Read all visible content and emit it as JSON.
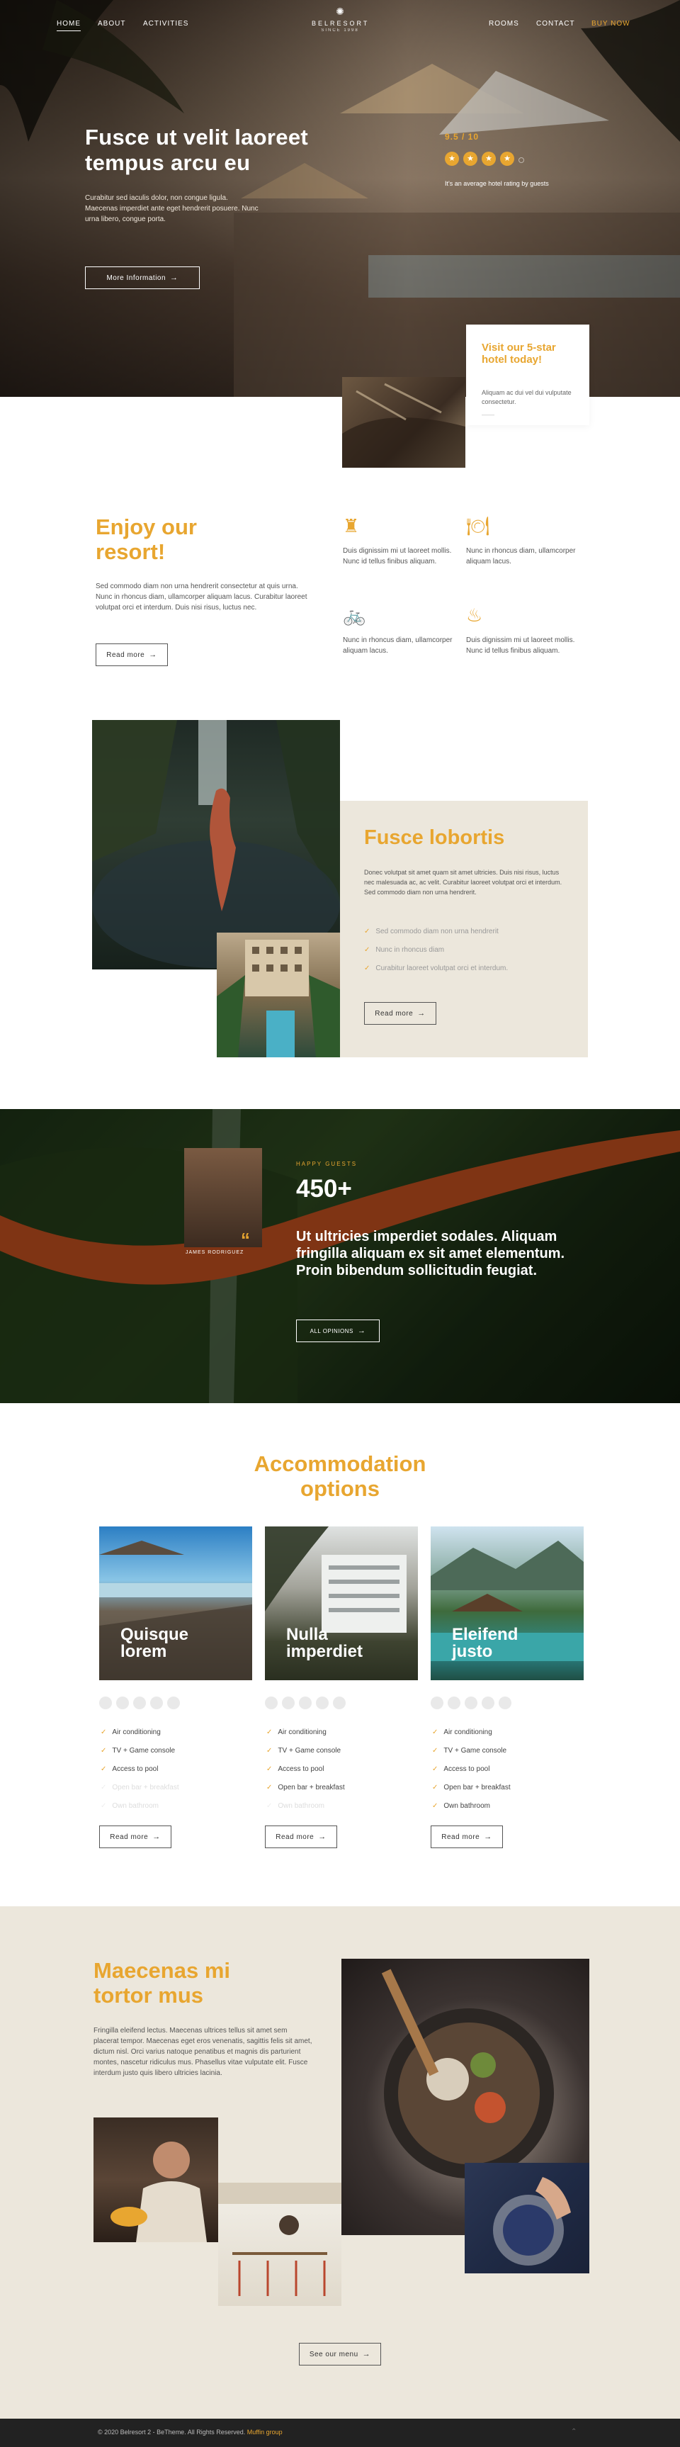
{
  "nav": {
    "left": [
      "HOME",
      "ABOUT",
      "ACTIVITIES"
    ],
    "logo_name": "BELRESORT",
    "logo_tag": "SINCE 1998",
    "right": [
      "ROOMS",
      "CONTACT",
      "BUY NOW"
    ]
  },
  "hero": {
    "title_line1": "Fusce ut velit laoreet",
    "title_line2": "tempus arcu eu",
    "text": "Curabitur sed iaculis dolor, non congue ligula. Maecenas imperdiet ante eget hendrerit posuere. Nunc urna libero, congue porta.",
    "button": "More Information",
    "rating": "9.5 / 10",
    "rating_stars": 4,
    "rating_caption": "It's an average hotel rating by guests",
    "promo_title": "Visit our 5-star hotel today!",
    "promo_text": "Aliquam ac dui vel dui vulputate consectetur.",
    "promo_dash": "——"
  },
  "enjoy": {
    "title_line1": "Enjoy our",
    "title_line2": "resort!",
    "text": "Sed commodo diam non urna hendrerit consectetur at quis urna. Nunc in rhoncus diam, ullamcorper aliquam lacus. Curabitur laoreet volutpat orci et interdum. Duis nisi risus, luctus nec.",
    "button": "Read more",
    "features": [
      {
        "icon": "castle-icon",
        "glyph": "♜",
        "text": "Duis dignissim mi ut laoreet mollis. Nunc id tellus finibus aliquam."
      },
      {
        "icon": "meal-icon",
        "glyph": "🍽",
        "text": "Nunc in rhoncus diam, ullamcorper aliquam lacus."
      },
      {
        "icon": "bicycle-icon",
        "glyph": "🚲",
        "text": "Nunc in rhoncus diam, ullamcorper aliquam lacus."
      },
      {
        "icon": "pool-icon",
        "glyph": "♨",
        "text": "Duis dignissim mi ut laoreet mollis. Nunc id tellus finibus aliquam."
      }
    ]
  },
  "fusce": {
    "title": "Fusce lobortis",
    "text": "Donec volutpat sit amet quam sit amet ultricies. Duis nisi risus, luctus nec malesuada ac, ac velit. Curabitur laoreet volutpat orci et interdum. Sed commodo diam non urna hendrerit.",
    "items": [
      "Sed commodo diam non urna hendrerit",
      "Nunc in rhoncus diam",
      "Curabitur laoreet volutpat orci et interdum."
    ],
    "button": "Read more"
  },
  "testimonial": {
    "label": "HAPPY GUESTS",
    "count": "450+",
    "quote": "Ut ultricies imperdiet sodales. Aliquam fringilla aliquam ex sit amet elementum. Proin bibendum sollicitudin feugiat.",
    "author": "JAMES RODRIGUEZ",
    "button": "ALL OPINIONS"
  },
  "accommodation": {
    "title_line1": "Accommodation",
    "title_line2": "options",
    "cards": [
      {
        "title1": "Quisque",
        "title2": "lorem",
        "features": [
          "Air conditioning",
          "TV + Game console",
          "Access to pool",
          "Open bar + breakfast",
          "Own bathroom"
        ],
        "faded_from": 3,
        "button": "Read more"
      },
      {
        "title1": "Nulla",
        "title2": "imperdiet",
        "features": [
          "Air conditioning",
          "TV + Game console",
          "Access to pool",
          "Open bar + breakfast",
          "Own bathroom"
        ],
        "faded_from": 4,
        "button": "Read more"
      },
      {
        "title1": "Eleifend",
        "title2": "justo",
        "features": [
          "Air conditioning",
          "TV + Game console",
          "Access to pool",
          "Open bar + breakfast",
          "Own bathroom"
        ],
        "faded_from": 5,
        "button": "Read more"
      }
    ]
  },
  "maecenas": {
    "title_line1": "Maecenas mi",
    "title_line2": "tortor mus",
    "text": "Fringilla eleifend lectus. Maecenas ultrices tellus sit amet sem placerat tempor. Maecenas eget eros venenatis, sagittis felis sit amet, dictum nisl. Orci varius natoque penatibus et magnis dis parturient montes, nascetur ridiculus mus. Phasellus vitae vulputate elit. Fusce interdum justo quis libero ultricies lacinia.",
    "button": "See our menu"
  },
  "footer": {
    "copyright": "© 2020 Belresort 2 - BeTheme. All Rights Reserved.",
    "brand": "Muffin group"
  },
  "colors": {
    "accent": "#e8a630",
    "beige": "#ece7dc",
    "dark": "#222"
  }
}
